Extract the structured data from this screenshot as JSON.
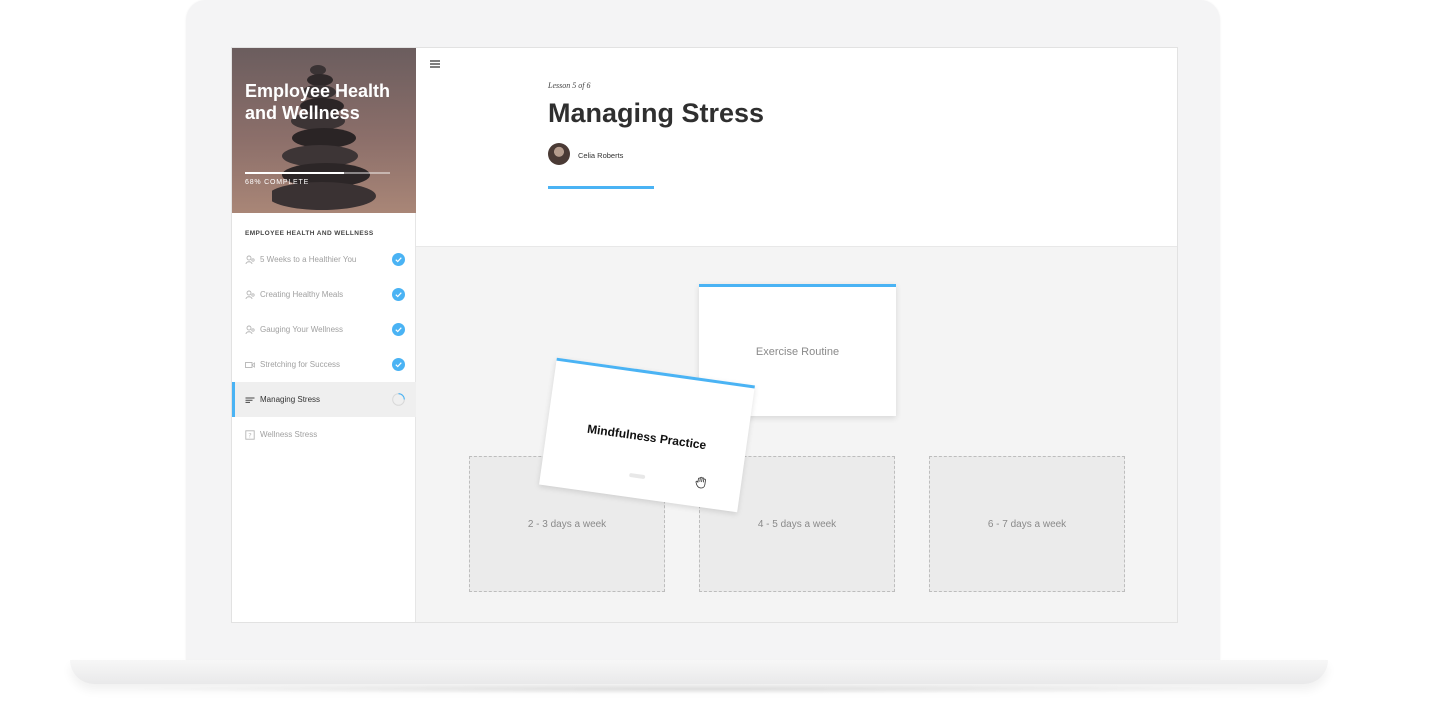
{
  "course": {
    "title": "Employee Health and Wellness",
    "progress_label": "68% COMPLETE",
    "progress_fraction": 0.68
  },
  "sidebar": {
    "section_heading": "EMPLOYEE HEALTH AND WELLNESS",
    "items": [
      {
        "label": "5 Weeks to a Healthier You",
        "icon": "people-icon",
        "status": "complete"
      },
      {
        "label": "Creating Healthy Meals",
        "icon": "people-icon",
        "status": "complete"
      },
      {
        "label": "Gauging Your Wellness",
        "icon": "people-icon",
        "status": "complete"
      },
      {
        "label": "Stretching for Success",
        "icon": "video-icon",
        "status": "complete"
      },
      {
        "label": "Managing Stress",
        "icon": "text-lines-icon",
        "status": "in-progress"
      },
      {
        "label": "Wellness Stress",
        "icon": "quiz-icon",
        "status": "not-started"
      }
    ]
  },
  "lesson": {
    "counter": "Lesson 5 of 6",
    "title": "Managing Stress",
    "author": "Celia Roberts"
  },
  "sorting": {
    "cards": [
      "Exercise Routine",
      "Mindfulness Practice"
    ],
    "zones": [
      "2 - 3 days a week",
      "4 - 5 days a week",
      "6 - 7 days a week"
    ]
  },
  "colors": {
    "accent": "#4ab3f4",
    "complete": "#4ab3f4"
  }
}
